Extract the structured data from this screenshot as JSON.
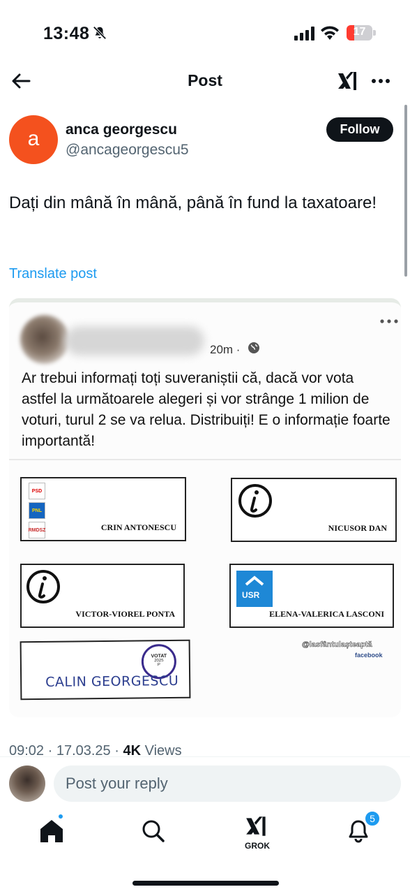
{
  "status_bar": {
    "time": "13:48",
    "battery": "17"
  },
  "header": {
    "title": "Post"
  },
  "author": {
    "avatar_letter": "a",
    "name": "anca georgescu",
    "handle": "@ancageorgescu5",
    "follow_label": "Follow"
  },
  "post": {
    "text": "Dați din mână în mână, până în fund la taxatoare!",
    "translate_label": "Translate post"
  },
  "embedded": {
    "time": "20m ·",
    "text": "Ar trebui informați toți suveraniștii că, dacă vor vota astfel la următoarele alegeri și vor strânge 1 milion de voturi, turul 2 se va relua. Distribuiți! E o informație foarte importantă!",
    "ballots": {
      "b1": {
        "name": "CRIN ANTONESCU",
        "logos": [
          "PSD",
          "PNL",
          "RMDSZ"
        ]
      },
      "b2": {
        "name": "NICUSOR DAN"
      },
      "b3": {
        "name": "VICTOR-VIOREL PONTA"
      },
      "b4": {
        "name": "ELENA-VALERICA LASCONI",
        "logo": "USR"
      },
      "b5": {
        "name": "CALIN GEORGESCU",
        "stamp_line1": "VOTAT",
        "stamp_line2": "2025",
        "stamp_line3": "P"
      }
    },
    "watermark": "@lasfântulașteaptă",
    "watermark_source": "facebook"
  },
  "meta": {
    "time_date": "09:02 · 17.03.25 · ",
    "views_count": "4K",
    "views_label": " Views"
  },
  "reply": {
    "placeholder": "Post your reply"
  },
  "tabbar": {
    "grok_label": "GROK",
    "notifications_count": "5"
  },
  "colors": {
    "accent": "#1d9bf0",
    "avatar": "#f4511e",
    "text": "#0f1419",
    "muted": "#536471"
  },
  "icons": [
    "bell-slash-icon",
    "signal-icon",
    "wifi-icon",
    "battery-icon",
    "back-arrow-icon",
    "xai-icon",
    "more-icon",
    "globe-icon",
    "home-icon",
    "search-icon",
    "grok-icon",
    "bell-icon"
  ]
}
